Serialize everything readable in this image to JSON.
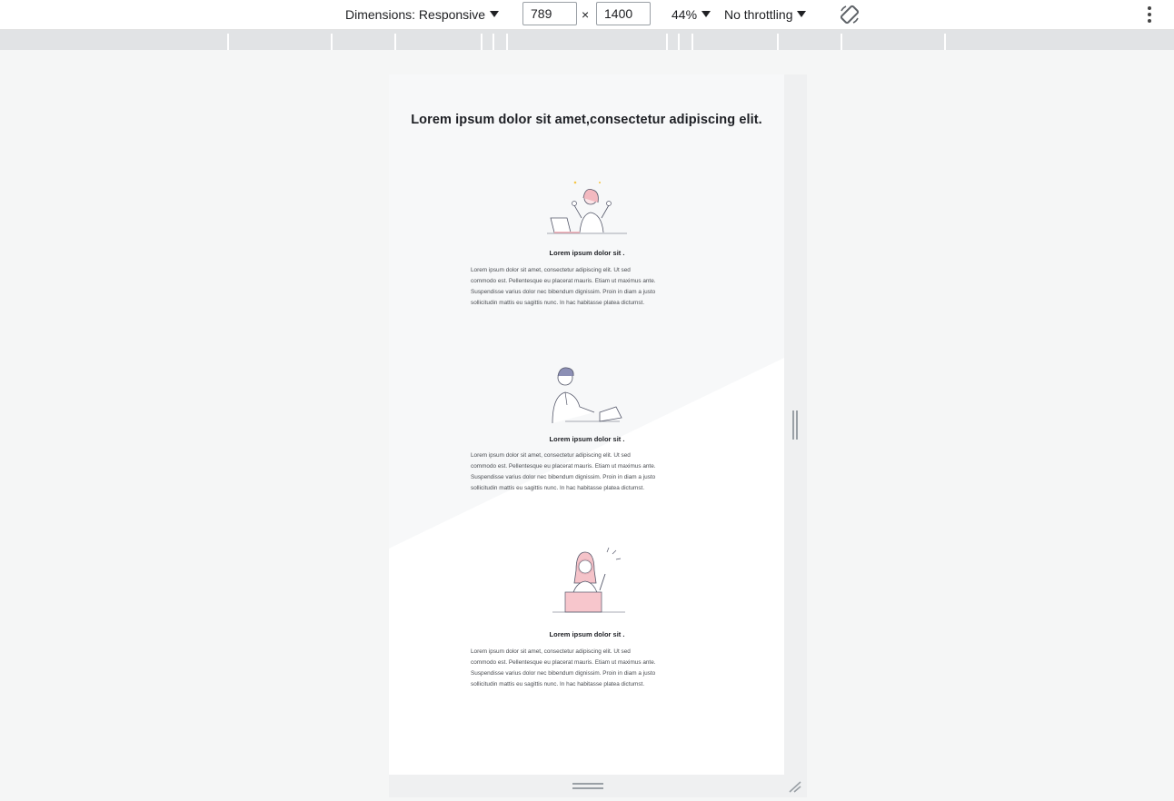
{
  "toolbar": {
    "dimensions_label": "Dimensions: Responsive",
    "width_value": "789",
    "height_value": "1400",
    "times_symbol": "×",
    "zoom_label": "44%",
    "throttling_label": "No throttling",
    "rotate_icon": "rotate-icon",
    "more_icon": "kebab-icon"
  },
  "page": {
    "heading": "Lorem ipsum dolor sit amet,consectetur adipiscing elit.",
    "cards": [
      {
        "illustration": "woman-celebrating-at-laptop",
        "title": "Lorem ipsum dolor sit .",
        "body": "Lorem ipsum dolor sit amet, consectetur adipiscing elit. Ut sed\ncommodo est. Pellentesque eu placerat mauris. Etiam ut maximus ante.\nSuspendisse varius dolor nec bibendum dignissim. Proin in diam a justo\nsollicitudin mattis eu sagittis nunc. In hac habitasse platea dictumst."
      },
      {
        "illustration": "man-typing-on-laptop",
        "title": "Lorem ipsum dolor sit .",
        "body": "Lorem ipsum dolor sit amet, consectetur adipiscing elit. Ut sed\ncommodo est. Pellentesque eu placerat mauris. Etiam ut maximus ante.\nSuspendisse varius dolor nec bibendum dignissim. Proin in diam a justo\nsollicitudin mattis eu sagittis nunc. In hac habitasse platea dictumst."
      },
      {
        "illustration": "woman-with-idea-at-laptop",
        "title": "Lorem ipsum dolor sit .",
        "body": "Lorem ipsum dolor sit amet, consectetur adipiscing elit. Ut sed\ncommodo est. Pellentesque eu placerat mauris. Etiam ut maximus ante.\nSuspendisse varius dolor nec bibendum dignissim. Proin in diam a justo\nsollicitudin mattis eu sagittis nunc. In hac habitasse platea dictumst."
      }
    ]
  },
  "colors": {
    "accent_pink": "#f3b9c0",
    "accent_yellow": "#f5c542",
    "line": "#55586a",
    "man_hair": "#8c8fb5"
  }
}
